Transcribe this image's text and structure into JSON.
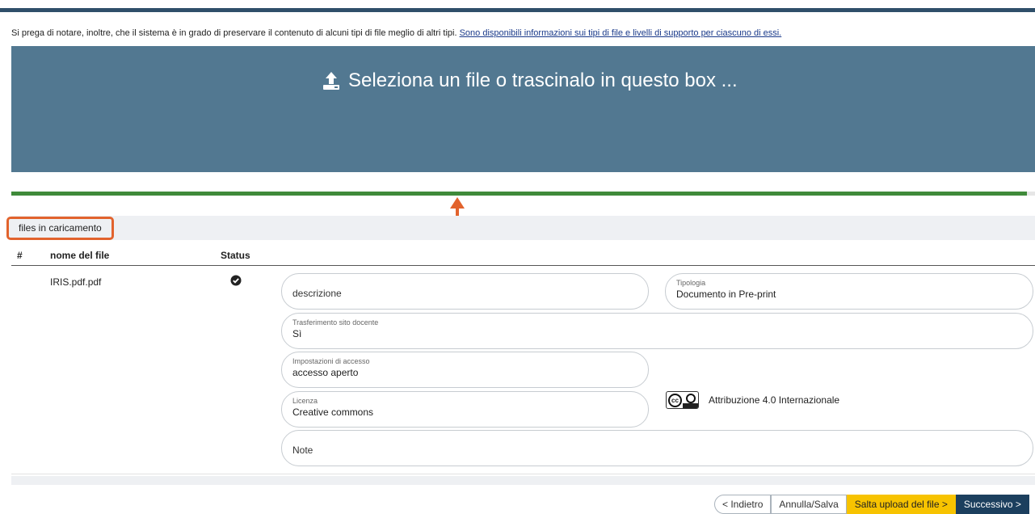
{
  "notice": {
    "text": "Si prega di notare, inoltre, che il sistema è in grado di preservare il contenuto di alcuni tipi di file meglio di altri tipi.",
    "link": "Sono disponibili informazioni sui tipi di file e livelli di supporto per ciascuno di essi."
  },
  "dropzone": {
    "label": "Seleziona un file o trascinalo in questo box ...",
    "icon": "upload-icon"
  },
  "upload_progress": 1.0,
  "colors": {
    "dropzone": "#527891",
    "progress": "#3f8a3a",
    "highlight": "#e2632d",
    "skip_button": "#f7c300",
    "next_button": "#1c3f5e"
  },
  "files_panel": {
    "tab_label": "files in caricamento",
    "columns": [
      "#",
      "nome del file",
      "Status"
    ],
    "rows": [
      {
        "name": "IRIS.pdf.pdf",
        "status_icon": "check-circle-icon",
        "fields": {
          "description": {
            "placeholder": "descrizione"
          },
          "type": {
            "label": "Tipologia",
            "value": "Documento in Pre-print"
          },
          "transfer": {
            "label": "Trasferimento sito docente",
            "value": "Sì"
          },
          "access": {
            "label": "Impostazioni di accesso",
            "value": "accesso aperto"
          },
          "license": {
            "label": "Licenza",
            "value": "Creative commons"
          },
          "notes": {
            "placeholder": "Note"
          }
        },
        "license_name": "Attribuzione 4.0 Internazionale",
        "license_icon": "cc-by-icon"
      }
    ]
  },
  "buttons": {
    "back": "< Indietro",
    "save": "Annulla/Salva",
    "skip": "Salta upload del file >",
    "next": "Successivo >"
  }
}
